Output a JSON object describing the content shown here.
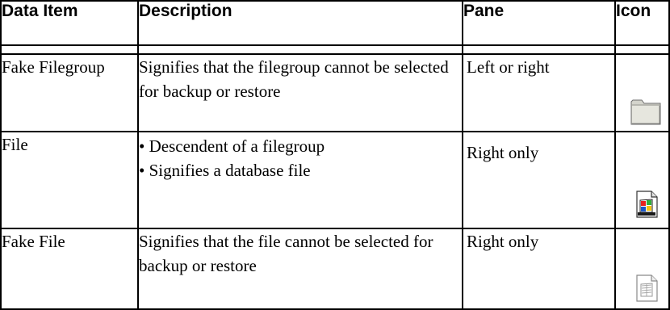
{
  "headers": {
    "data_item": "Data Item",
    "description": "Description",
    "pane": "Pane",
    "icon": "Icon"
  },
  "rows": [
    {
      "data_item": "Fake Filegroup",
      "description": "Signifies that the filegroup cannot be selected for backup or restore",
      "pane": "Left or right",
      "icon": "folder-grey-icon"
    },
    {
      "data_item": "File",
      "description_bullets": [
        "Descendent of a filegroup",
        "Signifies a database file"
      ],
      "pane": "Right only",
      "icon": "database-file-icon"
    },
    {
      "data_item": "Fake File",
      "description": "Signifies that the file cannot be selected for backup or restore",
      "pane": "Right only",
      "icon": "fake-file-icon"
    }
  ]
}
